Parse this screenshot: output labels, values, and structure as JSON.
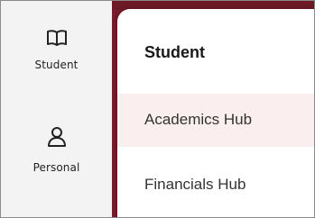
{
  "rail": {
    "items": [
      {
        "label": "Student",
        "icon": "book-icon"
      },
      {
        "label": "Personal",
        "icon": "person-icon"
      }
    ]
  },
  "flyout": {
    "title": "Student",
    "items": [
      {
        "label": "Academics Hub",
        "active": true
      },
      {
        "label": "Financials Hub",
        "active": false
      }
    ]
  },
  "colors": {
    "accent": "#7b1f2c",
    "active_bg": "#fbeeee",
    "rail_bg": "#f3f3f3"
  }
}
